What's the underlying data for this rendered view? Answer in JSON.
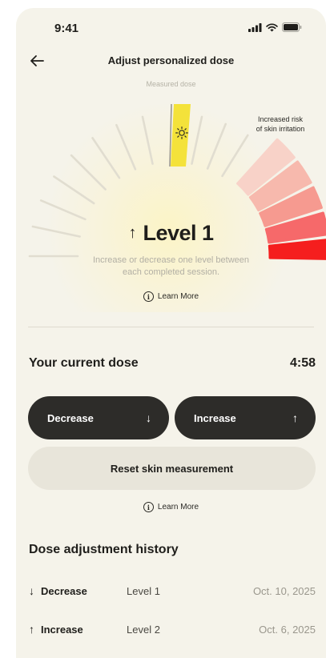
{
  "status_bar": {
    "time": "9:41",
    "icons": [
      "cellular-signal-icon",
      "wifi-icon",
      "battery-icon"
    ]
  },
  "header": {
    "title": "Adjust personalized dose",
    "back_icon": "arrow-left-icon"
  },
  "gauge": {
    "measured_label": "Measured dose",
    "risk_label_line1": "Increased risk",
    "risk_label_line2": "of skin irritation",
    "marker_icon": "sun-icon",
    "level_arrow": "↑",
    "level_text": "Level 1",
    "hint_line1": "Increase or decrease one level between",
    "hint_line2": "each completed session.",
    "learn_more": "Learn More",
    "colors": {
      "measured": "#f4e23a",
      "risk_levels": [
        "#f8d2c8",
        "#f7b9ad",
        "#f69a90",
        "#f6696a",
        "#f51e1e"
      ],
      "ticks": "#e1ddd0"
    }
  },
  "current_dose": {
    "title": "Your current dose",
    "timer": "4:58",
    "decrease_label": "Decrease",
    "decrease_arrow": "↓",
    "increase_label": "Increase",
    "increase_arrow": "↑",
    "reset_label": "Reset skin measurement",
    "learn_more": "Learn More"
  },
  "history": {
    "title": "Dose adjustment history",
    "rows": [
      {
        "arrow": "↓",
        "action": "Decrease",
        "level": "Level 1",
        "date": "Oct. 10, 2025"
      },
      {
        "arrow": "↑",
        "action": "Increase",
        "level": "Level 2",
        "date": "Oct. 6, 2025"
      }
    ]
  }
}
